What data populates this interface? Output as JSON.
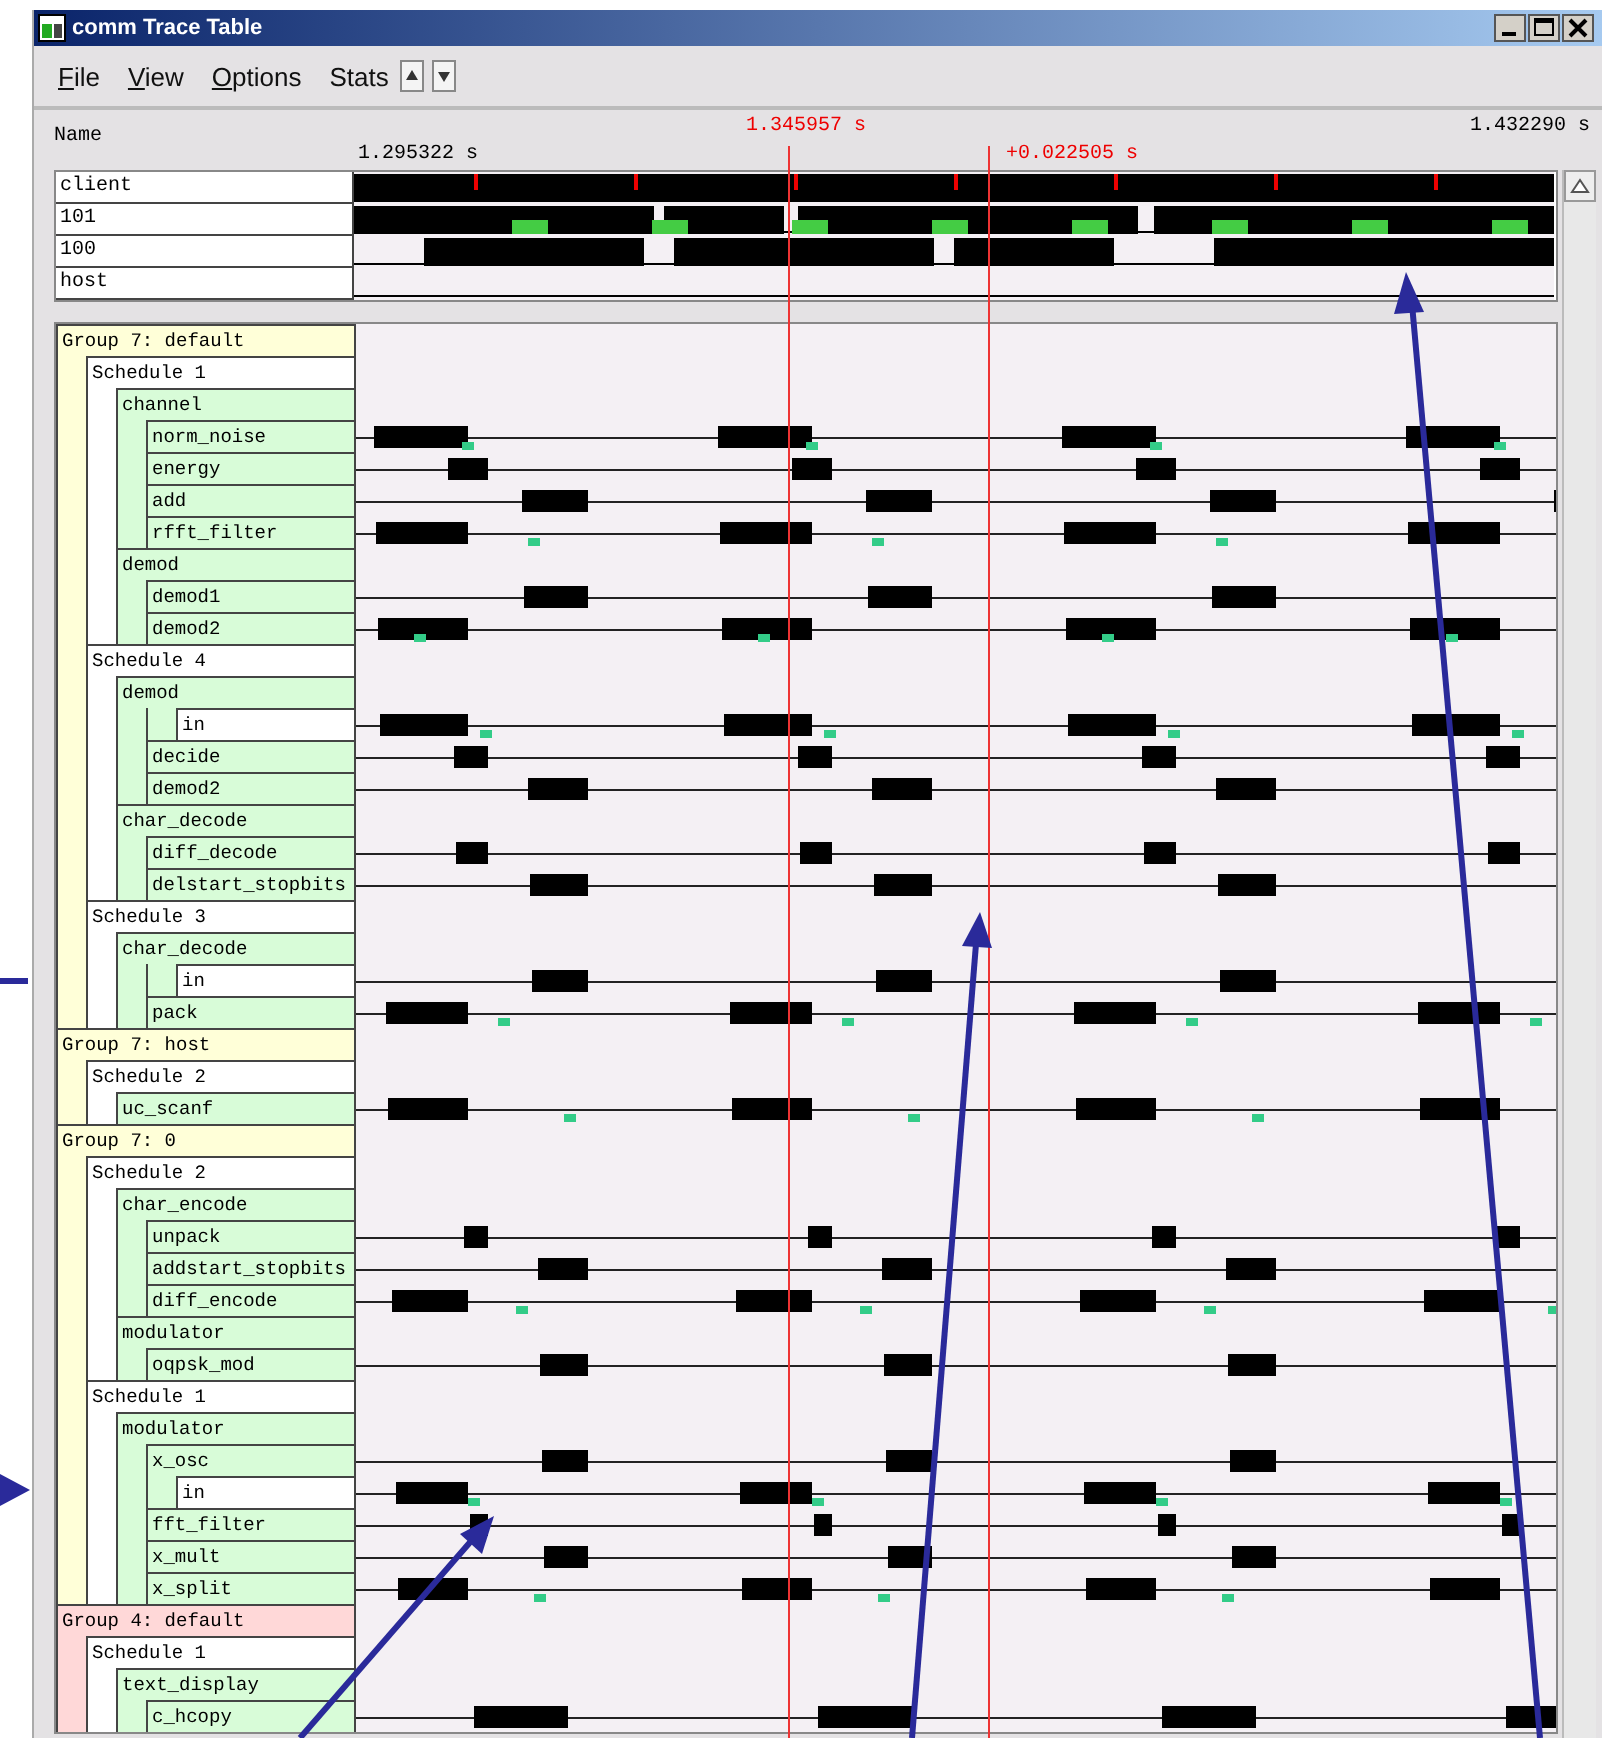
{
  "window": {
    "title": "comm Trace Table"
  },
  "menu": [
    {
      "label": "File",
      "mnemonic": true
    },
    {
      "label": "View",
      "mnemonic": true
    },
    {
      "label": "Options",
      "mnemonic": true
    },
    {
      "label": "Stats",
      "mnemonic": false
    }
  ],
  "timeline": {
    "name_header": "Name",
    "start": "1.295322 s",
    "cursor": "1.345957 s",
    "delta": "+0.022505 s",
    "end": "1.432290 s"
  },
  "overview": [
    "client",
    "101",
    "100",
    "host"
  ],
  "tree": [
    {
      "label": "Group 7: default",
      "kind": "group",
      "color": "#ffffd8",
      "children": [
        {
          "label": "Schedule 1",
          "kind": "schedule",
          "children": [
            {
              "label": "channel",
              "kind": "module",
              "children": [
                {
                  "label": "norm_noise",
                  "kind": "task"
                },
                {
                  "label": "energy",
                  "kind": "task"
                },
                {
                  "label": "add",
                  "kind": "task"
                },
                {
                  "label": "rfft_filter",
                  "kind": "task"
                }
              ]
            },
            {
              "label": "demod",
              "kind": "module",
              "children": [
                {
                  "label": "demod1",
                  "kind": "task"
                },
                {
                  "label": "demod2",
                  "kind": "task"
                }
              ]
            }
          ]
        },
        {
          "label": "Schedule 4",
          "kind": "schedule",
          "children": [
            {
              "label": "demod",
              "kind": "module",
              "children": [
                {
                  "label": "in",
                  "kind": "port"
                },
                {
                  "label": "decide",
                  "kind": "task"
                },
                {
                  "label": "demod2",
                  "kind": "task"
                }
              ]
            },
            {
              "label": "char_decode",
              "kind": "module",
              "children": [
                {
                  "label": "diff_decode",
                  "kind": "task"
                },
                {
                  "label": "delstart_stopbits",
                  "kind": "task"
                }
              ]
            }
          ]
        },
        {
          "label": "Schedule 3",
          "kind": "schedule",
          "children": [
            {
              "label": "char_decode",
              "kind": "module",
              "children": [
                {
                  "label": "in",
                  "kind": "port"
                },
                {
                  "label": "pack",
                  "kind": "task"
                }
              ]
            }
          ]
        }
      ]
    },
    {
      "label": "Group 7: host",
      "kind": "group",
      "color": "#ffffd8",
      "children": [
        {
          "label": "Schedule 2",
          "kind": "schedule",
          "children": [
            {
              "label": "uc_scanf",
              "kind": "module"
            }
          ]
        }
      ]
    },
    {
      "label": "Group 7: 0",
      "kind": "group",
      "color": "#ffffd8",
      "children": [
        {
          "label": "Schedule 2",
          "kind": "schedule",
          "children": [
            {
              "label": "char_encode",
              "kind": "module",
              "children": [
                {
                  "label": "unpack",
                  "kind": "task"
                },
                {
                  "label": "addstart_stopbits",
                  "kind": "task"
                },
                {
                  "label": "diff_encode",
                  "kind": "task"
                }
              ]
            },
            {
              "label": "modulator",
              "kind": "module",
              "children": [
                {
                  "label": "oqpsk_mod",
                  "kind": "task"
                }
              ]
            }
          ]
        },
        {
          "label": "Schedule 1",
          "kind": "schedule",
          "children": [
            {
              "label": "modulator",
              "kind": "module",
              "children": [
                {
                  "label": "x_osc",
                  "kind": "task"
                },
                {
                  "label": "in",
                  "kind": "port"
                },
                {
                  "label": "fft_filter",
                  "kind": "task"
                },
                {
                  "label": "x_mult",
                  "kind": "task"
                },
                {
                  "label": "x_split",
                  "kind": "task"
                }
              ]
            }
          ]
        }
      ]
    },
    {
      "label": "Group 4: default",
      "kind": "group",
      "color": "#ffd8d8",
      "children": [
        {
          "label": "Schedule 1",
          "kind": "schedule",
          "children": [
            {
              "label": "text_display",
              "kind": "module",
              "children": [
                {
                  "label": "c_hcopy",
                  "kind": "task"
                }
              ]
            }
          ]
        }
      ]
    }
  ]
}
